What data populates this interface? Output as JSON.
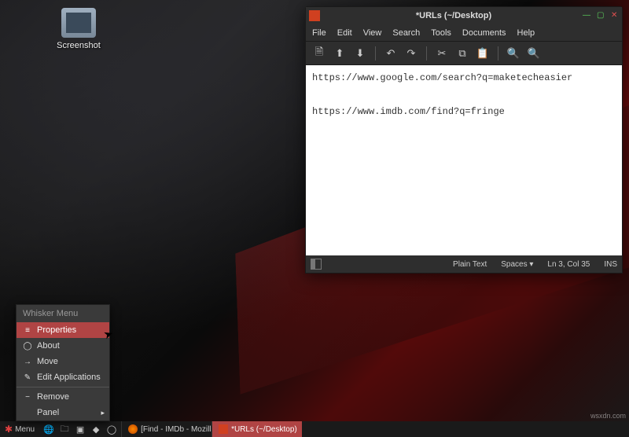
{
  "desktop": {
    "icon_label": "Screenshot"
  },
  "editor": {
    "title": "*URLs (~/Desktop)",
    "menu": {
      "file": "File",
      "edit": "Edit",
      "view": "View",
      "search": "Search",
      "tools": "Tools",
      "documents": "Documents",
      "help": "Help"
    },
    "content": "https://www.google.com/search?q=maketecheasier\n\nhttps://www.imdb.com/find?q=fringe",
    "status": {
      "syntax": "Plain Text",
      "indent": "Spaces ▾",
      "position": "Ln 3, Col 35",
      "mode": "INS"
    }
  },
  "context_menu": {
    "header": "Whisker Menu",
    "items": {
      "properties": "Properties",
      "about": "About",
      "move": "Move",
      "edit_apps": "Edit Applications",
      "remove": "Remove",
      "panel": "Panel"
    }
  },
  "taskbar": {
    "menu_label": "Menu",
    "tasks": {
      "firefox": "[Find - IMDb - Mozilla F...",
      "editor": "*URLs (~/Desktop)"
    }
  },
  "watermark": "wsxdn.com"
}
